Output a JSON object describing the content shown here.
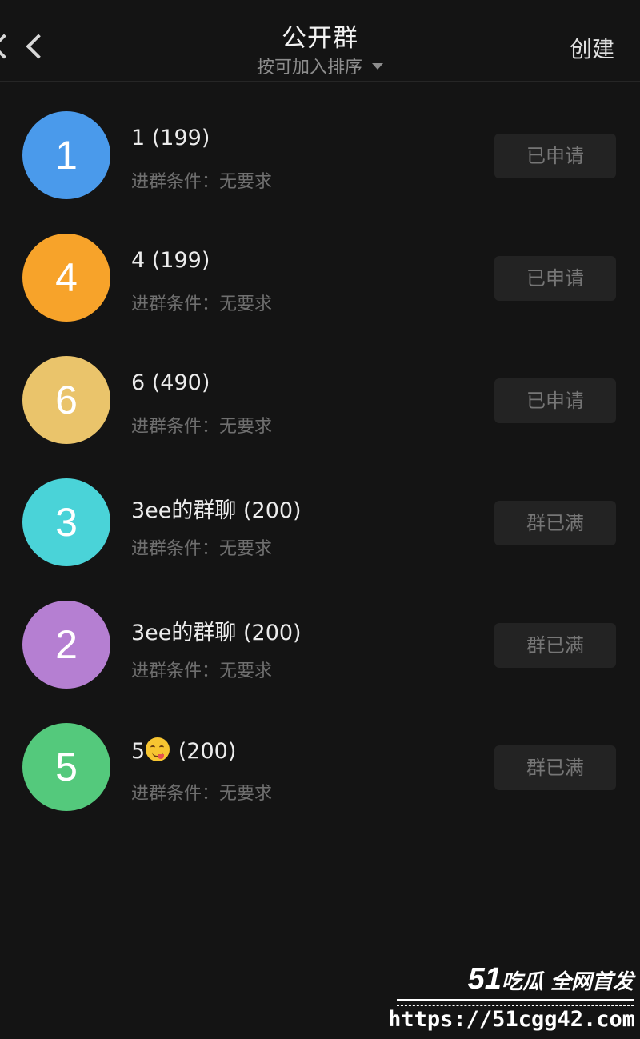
{
  "header": {
    "title": "公开群",
    "sort_label": "按可加入排序",
    "create_label": "创建"
  },
  "groups": [
    {
      "avatar": "1",
      "color": "#4a9aeb",
      "name": "1 (199)",
      "condition": "进群条件：无要求",
      "action": "已申请"
    },
    {
      "avatar": "4",
      "color": "#f7a32a",
      "name": "4 (199)",
      "condition": "进群条件：无要求",
      "action": "已申请"
    },
    {
      "avatar": "6",
      "color": "#eac46b",
      "name": "6 (490)",
      "condition": "进群条件：无要求",
      "action": "已申请"
    },
    {
      "avatar": "3",
      "color": "#4ad3d8",
      "name": "3ee的群聊 (200)",
      "condition": "进群条件：无要求",
      "action": "群已满"
    },
    {
      "avatar": "2",
      "color": "#b57fd2",
      "name": "3ee的群聊 (200)",
      "condition": "进群条件：无要求",
      "action": "群已满"
    },
    {
      "avatar": "5",
      "color": "#54c97c",
      "name_prefix": "5",
      "name_suffix": " (200)",
      "emoji": "face-savoring-food-emoji",
      "condition": "进群条件：无要求",
      "action": "群已满"
    }
  ],
  "watermark": {
    "brand_number": "51",
    "brand_text": "吃瓜 全网首发",
    "url": "https://51cgg42.com"
  }
}
